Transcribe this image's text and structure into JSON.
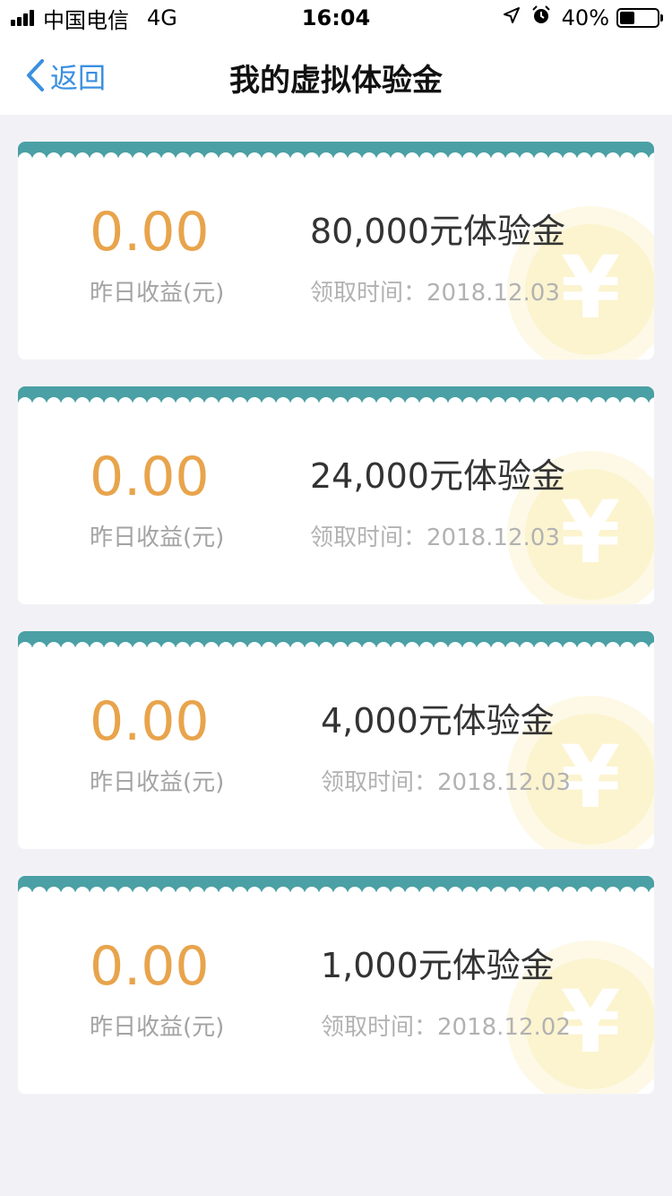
{
  "status_bar": {
    "carrier": "中国电信",
    "network": "4G",
    "time": "16:04",
    "battery": "40%",
    "battery_level": 0.4
  },
  "nav": {
    "back_label": "返回",
    "title": "我的虚拟体验金"
  },
  "cards": [
    {
      "earnings": "0.00",
      "earnings_label": "昨日收益(元)",
      "amount": "80,000元体验金",
      "claim_time": "领取时间：2018.12.03",
      "coin_symbol": "¥"
    },
    {
      "earnings": "0.00",
      "earnings_label": "昨日收益(元)",
      "amount": "24,000元体验金",
      "claim_time": "领取时间：2018.12.03",
      "coin_symbol": "¥"
    },
    {
      "earnings": "0.00",
      "earnings_label": "昨日收益(元)",
      "amount": "4,000元体验金",
      "claim_time": "领取时间：2018.12.03",
      "coin_symbol": "¥"
    },
    {
      "earnings": "0.00",
      "earnings_label": "昨日收益(元)",
      "amount": "1,000元体验金",
      "claim_time": "领取时间：2018.12.02",
      "coin_symbol": "¥"
    }
  ],
  "colors": {
    "accent": "#3b8fe0",
    "earnings": "#e8a44c",
    "card_header": "#4aa0a4"
  }
}
